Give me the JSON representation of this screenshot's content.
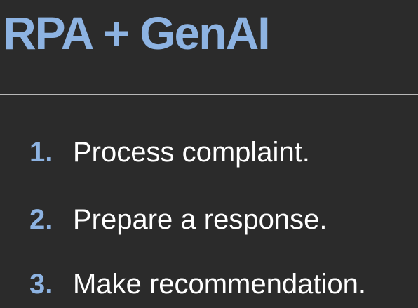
{
  "slide": {
    "title": "RPA + GenAI",
    "colors": {
      "background": "#2b2b2b",
      "accent": "#8db3e2",
      "text": "#ffffff",
      "divider": "#b8b8b8"
    },
    "items": [
      {
        "number": "1.",
        "text": "Process complaint."
      },
      {
        "number": "2.",
        "text": "Prepare a response."
      },
      {
        "number": "3.",
        "text": "Make recommendation."
      }
    ]
  }
}
